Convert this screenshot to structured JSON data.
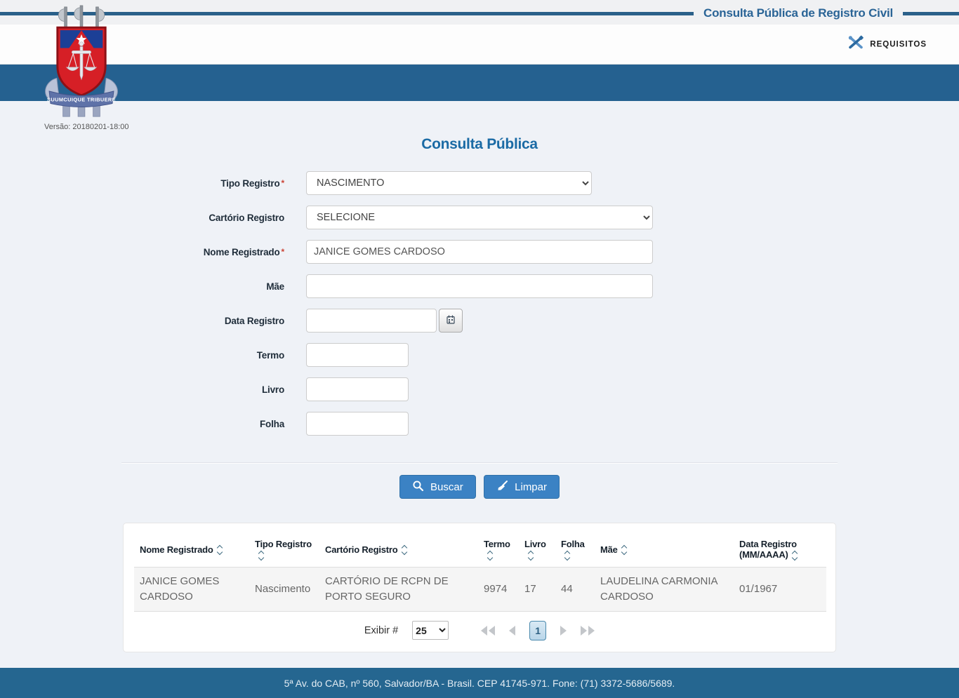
{
  "topbar": {
    "title": "Consulta Pública de Registro Civil"
  },
  "header": {
    "requisitos": "REQUISITOS"
  },
  "logo": {
    "motto": "SUUMCUIQUE TRIBUERE",
    "version": "Versão: 20180201-18:00"
  },
  "page": {
    "heading": "Consulta Pública"
  },
  "form": {
    "tipo_registro": {
      "label": "Tipo Registro",
      "required": "*",
      "value": "NASCIMENTO"
    },
    "cartorio_registro": {
      "label": "Cartório Registro",
      "value": "SELECIONE"
    },
    "nome_registrado": {
      "label": "Nome Registrado",
      "required": "*",
      "value": "JANICE GOMES CARDOSO"
    },
    "mae": {
      "label": "Mãe",
      "value": ""
    },
    "data_registro": {
      "label": "Data Registro",
      "value": ""
    },
    "termo": {
      "label": "Termo",
      "value": ""
    },
    "livro": {
      "label": "Livro",
      "value": ""
    },
    "folha": {
      "label": "Folha",
      "value": ""
    }
  },
  "actions": {
    "buscar": "Buscar",
    "limpar": "Limpar"
  },
  "table": {
    "headers": [
      "Nome Registrado",
      "Tipo Registro",
      "Cartório Registro",
      "Termo",
      "Livro",
      "Folha",
      "Mãe",
      "Data Registro (MM/AAAA)"
    ],
    "rows": [
      [
        "JANICE GOMES CARDOSO",
        "Nascimento",
        "CARTÓRIO DE RCPN DE PORTO SEGURO",
        "9974",
        "17",
        "44",
        "LAUDELINA CARMONIA CARDOSO",
        "01/1967"
      ]
    ]
  },
  "pagination": {
    "exibir_label": "Exibir #",
    "page_size": "25",
    "current_page": "1"
  },
  "footer": {
    "address": "5ª Av. do CAB, nº 560, Salvador/BA - Brasil. CEP 41745-971. Fone: (71) 3372-5686/5689."
  },
  "colors": {
    "top_rule": "#2a6089",
    "band_blue": "#256190",
    "heading_blue": "#1b6ba5",
    "button_blue": "#3b82c4",
    "footer_blue": "#256690",
    "row_gray": "#f5f5f5"
  }
}
